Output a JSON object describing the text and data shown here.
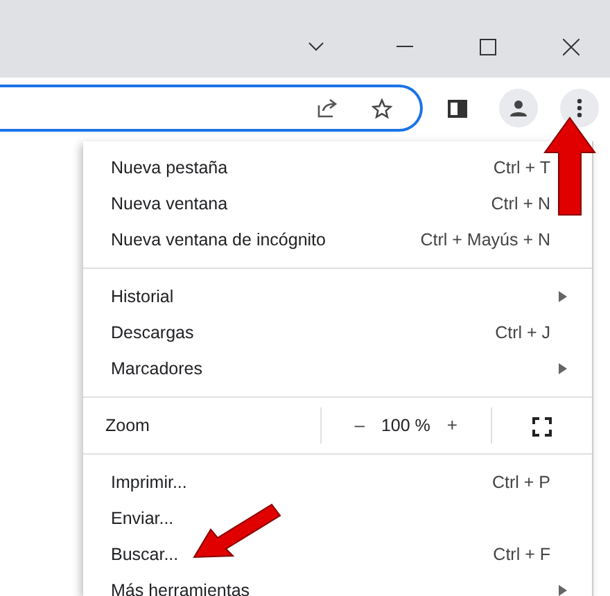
{
  "menu": {
    "entries": [
      {
        "kind": "item",
        "label": "Nueva pestaña",
        "shortcut": "Ctrl + T",
        "submenu": false
      },
      {
        "kind": "item",
        "label": "Nueva ventana",
        "shortcut": "Ctrl + N",
        "submenu": false
      },
      {
        "kind": "item",
        "label": "Nueva ventana de incógnito",
        "shortcut": "Ctrl + Mayús + N",
        "submenu": false
      },
      {
        "kind": "separator"
      },
      {
        "kind": "item",
        "label": "Historial",
        "submenu": true
      },
      {
        "kind": "item",
        "label": "Descargas",
        "shortcut": "Ctrl + J",
        "submenu": false
      },
      {
        "kind": "item",
        "label": "Marcadores",
        "submenu": true
      },
      {
        "kind": "separator"
      },
      {
        "kind": "zoom",
        "label": "Zoom",
        "minus": "–",
        "value": "100 %",
        "plus": "+"
      },
      {
        "kind": "separator"
      },
      {
        "kind": "item",
        "label": "Imprimir...",
        "shortcut": "Ctrl + P",
        "submenu": false
      },
      {
        "kind": "item",
        "label": "Enviar...",
        "submenu": false
      },
      {
        "kind": "item",
        "label": "Buscar...",
        "shortcut": "Ctrl + F",
        "submenu": false
      },
      {
        "kind": "item",
        "label": "Más herramientas",
        "submenu": true
      }
    ]
  }
}
